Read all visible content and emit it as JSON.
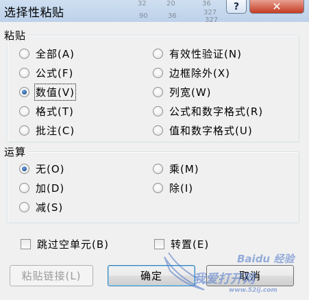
{
  "window": {
    "title": "选择性粘贴",
    "help_label": "?",
    "close_label": "✕",
    "background_cells": [
      "32",
      "20",
      "36",
      "327",
      "90",
      "36",
      "327"
    ]
  },
  "paste_group": {
    "label": "粘贴",
    "left_options": [
      {
        "label": "全部(A)",
        "checked": false
      },
      {
        "label": "公式(F)",
        "checked": false
      },
      {
        "label": "数值(V)",
        "checked": true
      },
      {
        "label": "格式(T)",
        "checked": false
      },
      {
        "label": "批注(C)",
        "checked": false
      }
    ],
    "right_options": [
      {
        "label": "有效性验证(N)",
        "checked": false
      },
      {
        "label": "边框除外(X)",
        "checked": false
      },
      {
        "label": "列宽(W)",
        "checked": false
      },
      {
        "label": "公式和数字格式(R)",
        "checked": false
      },
      {
        "label": "值和数字格式(U)",
        "checked": false
      }
    ]
  },
  "operation_group": {
    "label": "运算",
    "left_options": [
      {
        "label": "无(O)",
        "checked": true
      },
      {
        "label": "加(D)",
        "checked": false
      },
      {
        "label": "减(S)",
        "checked": false
      }
    ],
    "right_options": [
      {
        "label": "乘(M)",
        "checked": false
      },
      {
        "label": "除(I)",
        "checked": false
      }
    ]
  },
  "checkboxes": {
    "skip_blanks": {
      "label": "跳过空单元(B)",
      "checked": false
    },
    "transpose": {
      "label": "转置(E)",
      "checked": false
    }
  },
  "buttons": {
    "paste_link": "粘贴链接(L)",
    "ok": "确定",
    "cancel": "取消"
  },
  "watermark": {
    "brand": "Baidu 经验",
    "site": "我爱打开网",
    "url": "www.52ij.com"
  }
}
